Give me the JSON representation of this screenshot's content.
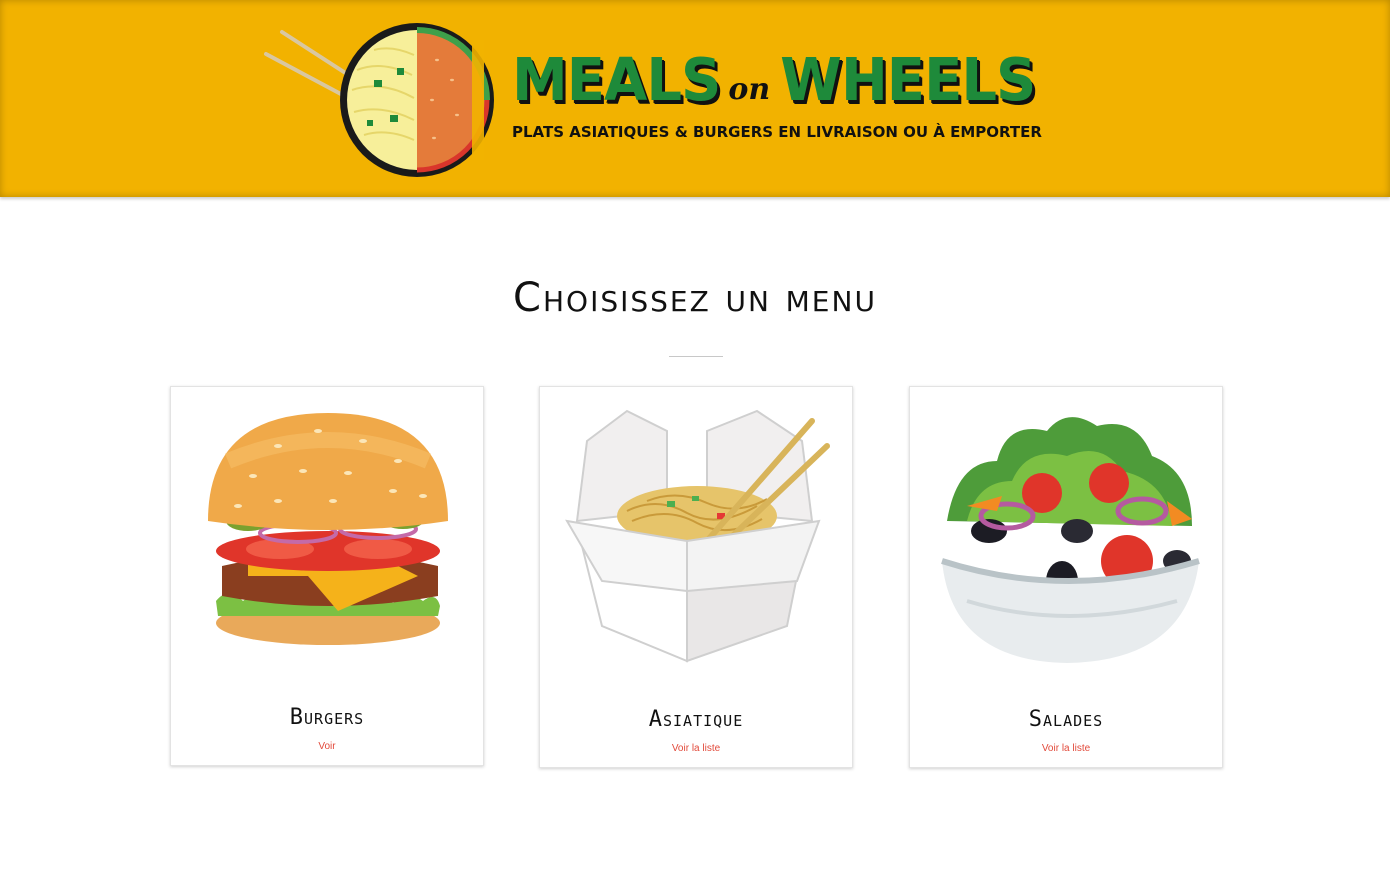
{
  "header": {
    "brand_word1": "MEALS",
    "brand_on": "on",
    "brand_word2": "WHEELS",
    "tagline": "PLATS ASIATIQUES & BURGERS EN LIVRAISON OU À EMPORTER"
  },
  "main": {
    "title": "Choisissez un menu",
    "cards": [
      {
        "title": "Burgers",
        "link": "Voir",
        "icon": "burger-illustration"
      },
      {
        "title": "Asiatique",
        "link": "Voir la liste",
        "icon": "noodle-box-illustration"
      },
      {
        "title": "Salades",
        "link": "Voir la liste",
        "icon": "salad-bowl-illustration"
      }
    ]
  },
  "colors": {
    "header_bg": "#f2b200",
    "brand_green": "#1e8a3a",
    "link_red": "#e24a3b"
  }
}
